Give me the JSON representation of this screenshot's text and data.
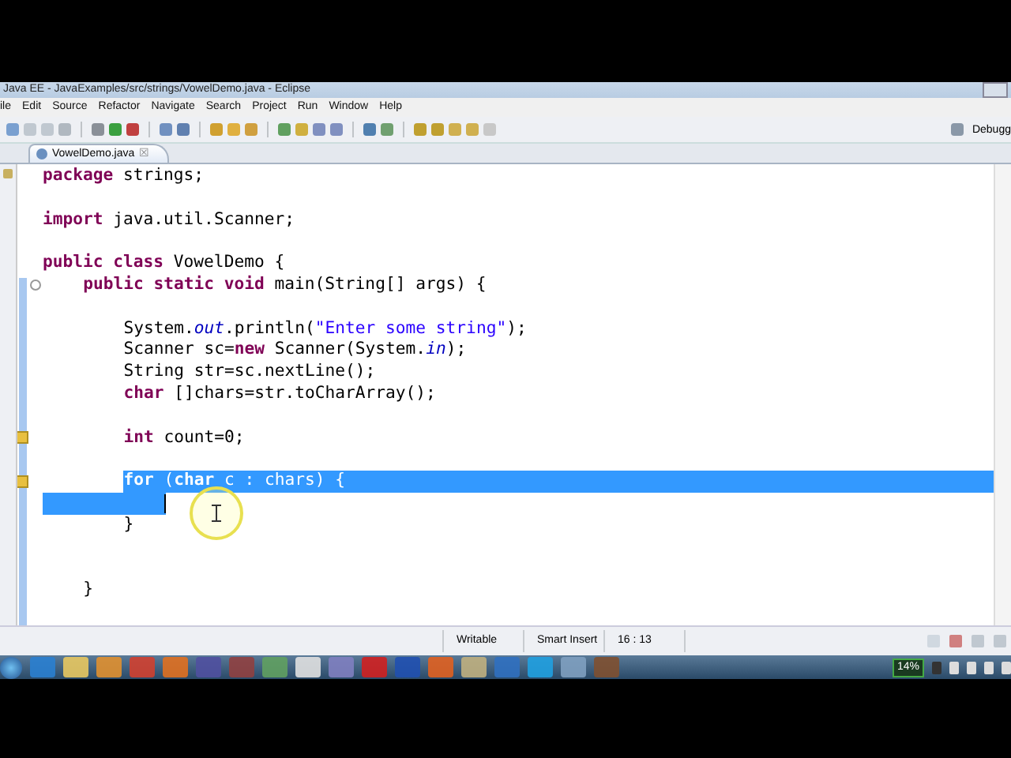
{
  "window": {
    "title": "Java EE - JavaExamples/src/strings/VowelDemo.java - Eclipse"
  },
  "menu": [
    "ile",
    "Edit",
    "Source",
    "Refactor",
    "Navigate",
    "Search",
    "Project",
    "Run",
    "Window",
    "Help"
  ],
  "perspective": {
    "label": "Debugg"
  },
  "tabs": [
    {
      "label": "VowelDemo.java",
      "close": "☒",
      "selected": true
    }
  ],
  "editor": {
    "lines": [
      {
        "selected": false,
        "segments": [
          {
            "kind": "kw",
            "text": "package"
          },
          {
            "kind": "plain",
            "text": " strings;"
          }
        ]
      },
      {
        "selected": false
      },
      {
        "selected": false,
        "segments": [
          {
            "kind": "kw",
            "text": "import"
          },
          {
            "kind": "plain",
            "text": " java.util.Scanner;"
          }
        ]
      },
      {
        "selected": false
      },
      {
        "selected": false,
        "segments": [
          {
            "kind": "kw",
            "text": "public class"
          },
          {
            "kind": "plain",
            "text": " VowelDemo {"
          }
        ],
        "children": [
          {
            "selected": false,
            "foldable": true,
            "segments": [
              {
                "kind": "kw",
                "text": "public static void"
              },
              {
                "kind": "plain",
                "text": " main(String[] args) {"
              }
            ],
            "children": [
              {
                "selected": false
              },
              {
                "selected": false,
                "segments": [
                  {
                    "kind": "plain",
                    "text": "System."
                  },
                  {
                    "kind": "field",
                    "text": "out"
                  },
                  {
                    "kind": "plain",
                    "text": ".println("
                  },
                  {
                    "kind": "str",
                    "text": "\"Enter some string\""
                  },
                  {
                    "kind": "plain",
                    "text": ");"
                  }
                ]
              },
              {
                "selected": false,
                "segments": [
                  {
                    "kind": "plain",
                    "text": "Scanner sc="
                  },
                  {
                    "kind": "kw",
                    "text": "new"
                  },
                  {
                    "kind": "plain",
                    "text": " Scanner(System."
                  },
                  {
                    "kind": "field",
                    "text": "in"
                  },
                  {
                    "kind": "plain",
                    "text": ");"
                  }
                ]
              },
              {
                "selected": false,
                "segments": [
                  {
                    "kind": "plain",
                    "text": "String str=sc.nextLine();"
                  }
                ]
              },
              {
                "selected": false,
                "segments": [
                  {
                    "kind": "kw",
                    "text": "char"
                  },
                  {
                    "kind": "plain",
                    "text": " []chars=str.toCharArray();"
                  }
                ]
              },
              {
                "selected": false
              },
              {
                "selected": false,
                "warning": true,
                "segments": [
                  {
                    "kind": "kw",
                    "text": "int"
                  },
                  {
                    "kind": "plain",
                    "text": " count=0;"
                  }
                ]
              },
              {
                "selected": false
              },
              {
                "selected": true,
                "warning": true,
                "segments": [
                  {
                    "kind": "kw",
                    "text": "for"
                  },
                  {
                    "kind": "plain",
                    "text": " ("
                  },
                  {
                    "kind": "kw",
                    "text": "char"
                  },
                  {
                    "kind": "plain",
                    "text": " c : chars) {"
                  }
                ],
                "children": [
                  {
                    "selected": true,
                    "caret": true
                  }
                ]
              },
              {
                "selected": false,
                "segments": [
                  {
                    "kind": "plain",
                    "text": "}"
                  }
                ]
              }
            ]
          },
          {
            "selected": false
          },
          {
            "selected": false
          },
          {
            "selected": false,
            "segments": [
              {
                "kind": "plain",
                "text": "}"
              }
            ]
          }
        ]
      }
    ]
  },
  "status_bar": {
    "fields": [
      "Writable",
      "Smart Insert",
      "16 : 13"
    ]
  },
  "taskbar": {
    "battery": "14%"
  }
}
